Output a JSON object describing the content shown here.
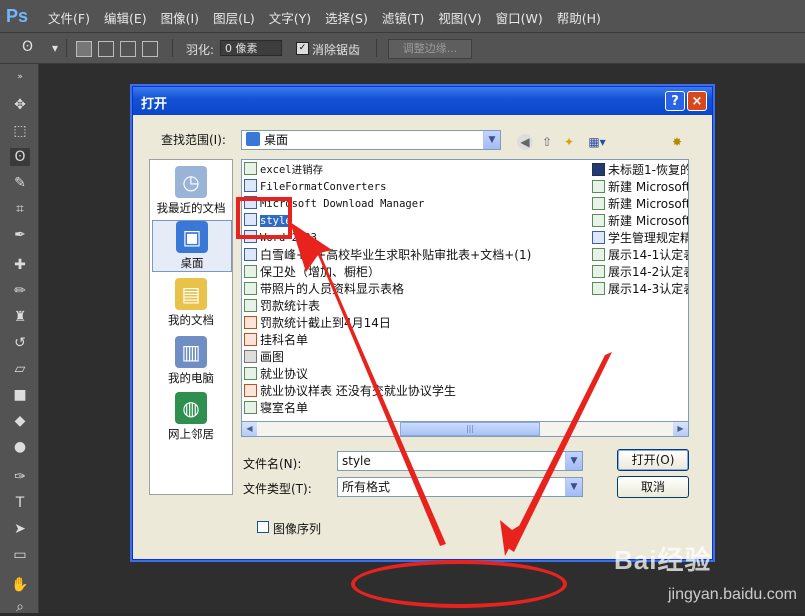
{
  "app": {
    "logo": "Ps",
    "menu": [
      "文件(F)",
      "编辑(E)",
      "图像(I)",
      "图层(L)",
      "文字(Y)",
      "选择(S)",
      "滤镜(T)",
      "视图(V)",
      "窗口(W)",
      "帮助(H)"
    ]
  },
  "options": {
    "feather_label": "羽化:",
    "feather_value": "0 像素",
    "antialias_label": "消除锯齿",
    "antialias_checked": true,
    "refine_edge": "调整边缘..."
  },
  "dialog": {
    "title": "打开",
    "help": "?",
    "close": "×",
    "look_in_label": "查找范围(I):",
    "look_in_value": "桌面",
    "places": [
      "我最近的文档",
      "桌面",
      "我的文档",
      "我的电脑",
      "网上邻居"
    ],
    "files_left": [
      {
        "name": "excel进销存",
        "type": "excel",
        "mono": true
      },
      {
        "name": "FileFormatConverters",
        "type": "word",
        "mono": true
      },
      {
        "name": "Microsoft Download Manager",
        "type": "word",
        "mono": true
      },
      {
        "name": "style",
        "type": "word",
        "mono": true,
        "selected": true
      },
      {
        "name": "Word 2003",
        "type": "word",
        "mono": true
      },
      {
        "name": "白雪峰+++高校毕业生求职补贴审批表+文档+(1)",
        "type": "word",
        "mono": false
      },
      {
        "name": "保卫处（增加、橱柜）",
        "type": "excel",
        "mono": false
      },
      {
        "name": "带照片的人员资料显示表格",
        "type": "excel",
        "mono": false
      },
      {
        "name": "罚款统计表",
        "type": "excel",
        "mono": false
      },
      {
        "name": "罚款统计截止到4月14日",
        "type": "ppt",
        "mono": false
      },
      {
        "name": "挂科名单",
        "type": "ppt",
        "mono": false
      },
      {
        "name": "画图",
        "type": "img",
        "mono": false
      },
      {
        "name": "就业协议",
        "type": "excel",
        "mono": false
      },
      {
        "name": "就业协议样表 还没有交就业协议学生",
        "type": "ppt",
        "mono": false
      },
      {
        "name": "寝室名单",
        "type": "excel",
        "mono": false
      }
    ],
    "files_right": [
      {
        "name": "未标题1-恢复的",
        "type": "ps"
      },
      {
        "name": "新建 Microsoft",
        "type": "excel"
      },
      {
        "name": "新建 Microsoft",
        "type": "excel"
      },
      {
        "name": "新建 Microsoft",
        "type": "excel"
      },
      {
        "name": "学生管理规定精",
        "type": "word"
      },
      {
        "name": "展示14-1认定表",
        "type": "excel"
      },
      {
        "name": "展示14-2认定表",
        "type": "excel"
      },
      {
        "name": "展示14-3认定表",
        "type": "excel"
      }
    ],
    "filename_label": "文件名(N):",
    "filename_value": "style",
    "filetype_label": "文件类型(T):",
    "filetype_value": "所有格式",
    "open_button": "打开(O)",
    "cancel_button": "取消",
    "sequence_label": "图像序列"
  },
  "watermark": {
    "brand": "Bai经验",
    "domain": "jingyan.baidu.com"
  },
  "colors": {
    "annotation": "#e8231d",
    "xp_title": "#0a46c9",
    "selection": "#316ac5"
  }
}
